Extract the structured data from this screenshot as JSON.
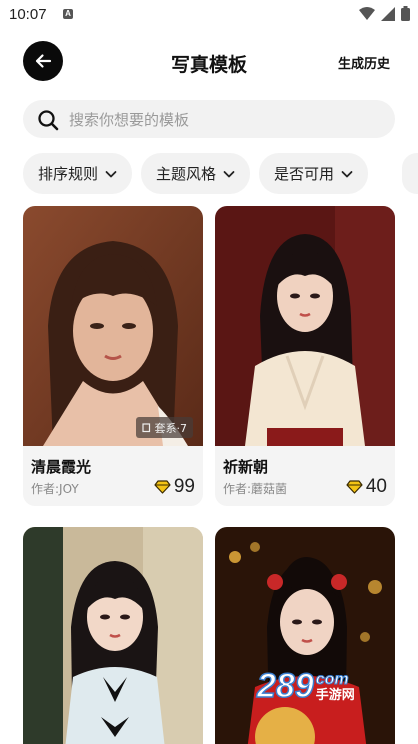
{
  "status_bar": {
    "time": "10:07",
    "notification_icon": "A"
  },
  "header": {
    "title": "写真模板",
    "history_label": "生成历史"
  },
  "search": {
    "placeholder": "搜索你想要的模板"
  },
  "filters": [
    {
      "label": "排序规则"
    },
    {
      "label": "主题风格"
    },
    {
      "label": "是否可用"
    }
  ],
  "cards": [
    {
      "name": "清晨霞光",
      "author": "作者:JOY",
      "price": "99",
      "tag": "套系·7"
    },
    {
      "name": "祈新朝",
      "author": "作者:蘑菇菌",
      "price": "40"
    },
    {
      "name": "",
      "author": "",
      "price": ""
    },
    {
      "name": "",
      "author": "",
      "price": ""
    }
  ],
  "watermark": {
    "text": "289",
    "suffix": "com",
    "sub": "手游网"
  },
  "colors": {
    "accent_dark": "#0a0a0a",
    "diamond": "#f3c314",
    "chip_bg": "#f2f2f2"
  }
}
